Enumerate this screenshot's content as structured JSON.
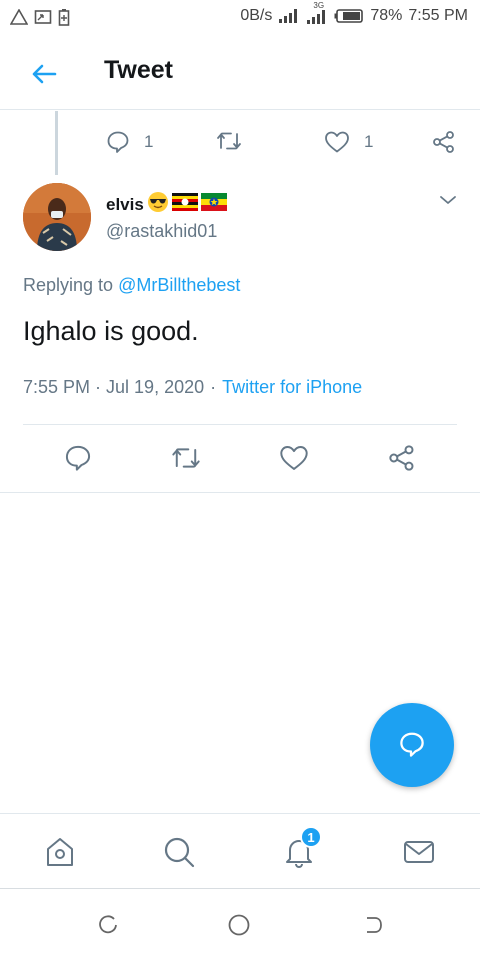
{
  "status_bar": {
    "speed": "0B/s",
    "network": "3G",
    "battery": "78%",
    "time": "7:55 PM",
    "icons": [
      "warning-icon",
      "cast-icon",
      "battery-saver-icon",
      "signal-icon",
      "signal-3g-icon",
      "battery-icon"
    ]
  },
  "header": {
    "title": "Tweet",
    "back_icon": "arrow-left-icon"
  },
  "parent_tweet": {
    "reply_count": "1",
    "like_count": "1"
  },
  "tweet": {
    "display_name": "elvis",
    "name_emojis": [
      "sunglasses-emoji",
      "uganda-flag",
      "ethiopia-flag"
    ],
    "handle": "@rastakhid01",
    "replying_prefix": "Replying to",
    "replying_to": "@MrBillthebest",
    "text": "Ighalo is good.",
    "timestamp": "7:55 PM · Jul 19, 2020",
    "separator": "·",
    "source": "Twitter for iPhone"
  },
  "actions": [
    "reply-icon",
    "retweet-icon",
    "like-icon",
    "share-icon"
  ],
  "bottom_nav": {
    "items": [
      "home-icon",
      "search-icon",
      "notifications-icon",
      "messages-icon"
    ],
    "notification_badge": "1"
  },
  "colors": {
    "accent": "#1da1f2",
    "text": "#14171a",
    "secondary": "#657786",
    "border": "#e1e8ed"
  }
}
